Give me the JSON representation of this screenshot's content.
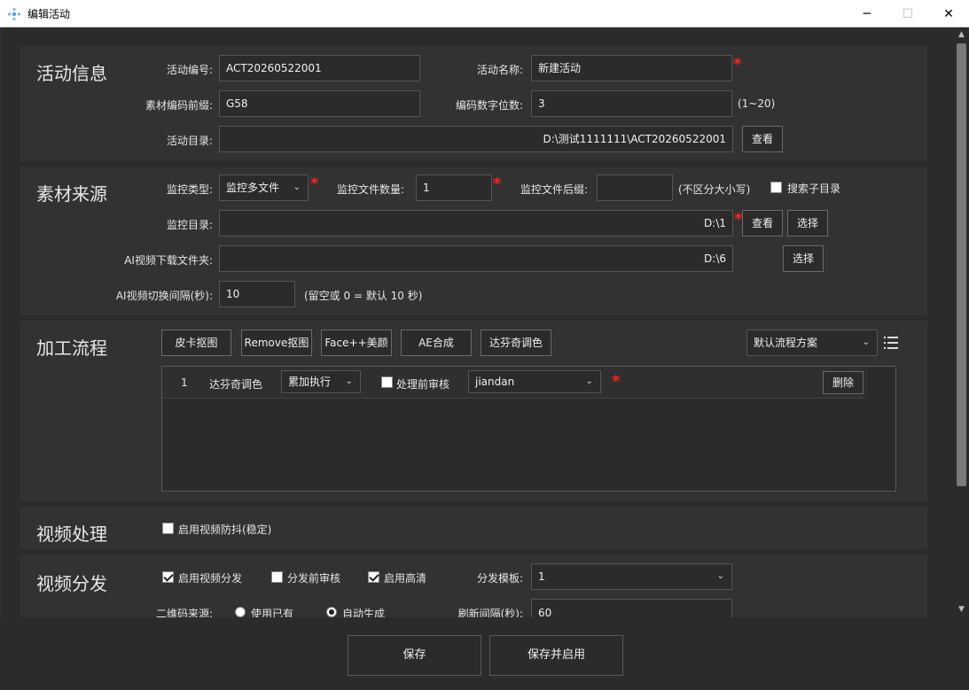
{
  "window": {
    "title": "编辑活动",
    "minimize": "─",
    "maximize": "☐",
    "close": "✕"
  },
  "activity": {
    "section_title": "活动信息",
    "code_label": "活动编号:",
    "code_value": "ACT20260522001",
    "name_label": "活动名称:",
    "name_value": "新建活动",
    "prefix_label": "素材编码前缀:",
    "prefix_value": "G58",
    "digits_label": "编码数字位数:",
    "digits_value": "3",
    "digits_hint": "(1~20)",
    "dir_label": "活动目录:",
    "dir_value": "D:\\测试1111111\\ACT20260522001",
    "view_btn": "查看"
  },
  "source": {
    "section_title": "素材来源",
    "type_label": "监控类型:",
    "type_value": "监控多文件",
    "count_label": "监控文件数量:",
    "count_value": "1",
    "suffix_label": "监控文件后缀:",
    "suffix_value": "",
    "suffix_hint": "(不区分大小写)",
    "subdir_label": "搜索子目录",
    "subdir_checked": false,
    "monitor_dir_label": "监控目录:",
    "monitor_dir_value": "D:\\1",
    "view_btn": "查看",
    "choose_btn": "选择",
    "ai_dl_label": "AI视频下载文件夹:",
    "ai_dl_value": "D:\\6",
    "ai_choose_btn": "选择",
    "ai_interval_label": "AI视频切换间隔(秒):",
    "ai_interval_value": "10",
    "ai_interval_hint": "(留空或 0 = 默认 10 秒)"
  },
  "process": {
    "section_title": "加工流程",
    "buttons": [
      "皮卡抠图",
      "Remove抠图",
      "Face++美颜",
      "AE合成",
      "达芬奇调色"
    ],
    "scheme_value": "默认流程方案",
    "row": {
      "index": "1",
      "name": "达芬奇调色",
      "mode": "累加执行",
      "review_label": "处理前审核",
      "review_checked": false,
      "user": "jiandan",
      "delete_btn": "删除"
    }
  },
  "video": {
    "section_title": "视频处理",
    "stabilize_label": "启用视频防抖(稳定)",
    "stabilize_checked": false
  },
  "distribute": {
    "section_title": "视频分发",
    "enable_label": "启用视频分发",
    "enable_checked": true,
    "pre_review_label": "分发前审核",
    "pre_review_checked": false,
    "hd_label": "启用高清",
    "hd_checked": true,
    "template_label": "分发模板:",
    "template_value": "1",
    "qr_label": "二维码来源:",
    "qr_use_existing": "使用已有",
    "qr_auto": "自动生成",
    "qr_selected": "自动生成",
    "refresh_label": "刷新间隔(秒):",
    "refresh_value": "60"
  },
  "footer": {
    "save": "保存",
    "save_enable": "保存并启用"
  }
}
